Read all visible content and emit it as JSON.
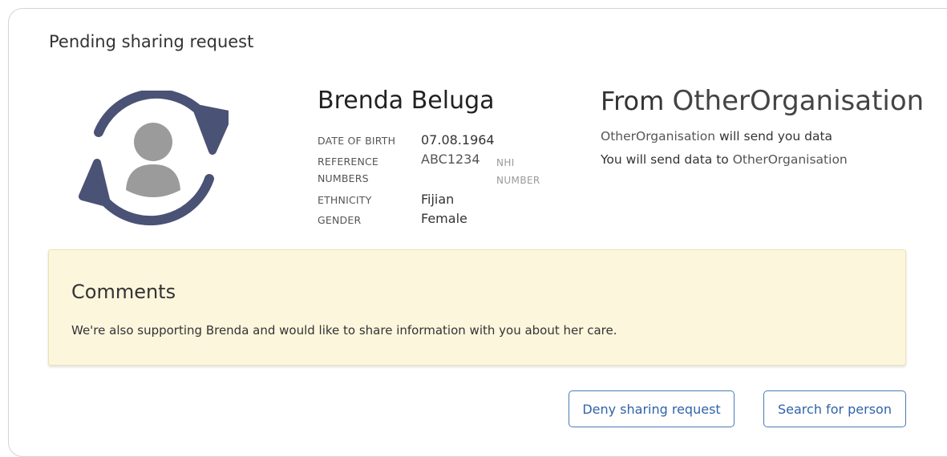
{
  "card": {
    "title": "Pending sharing request"
  },
  "person": {
    "name": "Brenda Beluga",
    "fields": {
      "dob_label": "DATE OF BIRTH",
      "dob_value": "07.08.1964",
      "ref_label_line1": "REFERENCE",
      "ref_label_line2": "NUMBERS",
      "ref_value": "ABC1234",
      "nhi_label_line1": "NHI",
      "nhi_label_line2": "NUMBER",
      "ethnicity_label": "ETHNICITY",
      "ethnicity_value": "Fijian",
      "gender_label": "GENDER",
      "gender_value": "Female"
    }
  },
  "from": {
    "prefix": "From",
    "organisation": "OtherOrganisation",
    "line1_org": "OtherOrganisation",
    "line1_text": " will send you data",
    "line2_text": "You will send data to ",
    "line2_org": "OtherOrganisation"
  },
  "comments": {
    "title": "Comments",
    "text": "We're also supporting Brenda and would like to share information with you about her care."
  },
  "actions": {
    "deny_label": "Deny sharing request",
    "search_label": "Search for person"
  },
  "colors": {
    "accent": "#2f63a8",
    "icon_ring": "#4a5275",
    "avatar_fill": "#9b9b9b",
    "comments_bg": "#fcf6dd"
  },
  "icons": {
    "avatar": "person-sync-icon"
  }
}
